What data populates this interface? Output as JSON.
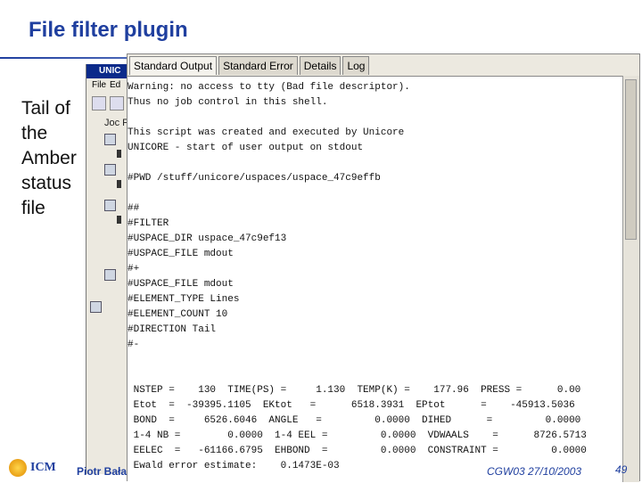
{
  "slide": {
    "title": "File filter plugin",
    "bullet_lines": [
      "Tail of",
      "the",
      "Amber",
      "status",
      "file"
    ],
    "footer_author": "Piotr Bała",
    "footer_event": "CGW03 27/10/2003",
    "page_number": "49",
    "logo_text": "ICM"
  },
  "background_window": {
    "title": "UNIC",
    "menu": [
      "File",
      "Ed"
    ],
    "tree_labels": [
      "Joc F",
      "",
      "",
      "",
      ""
    ]
  },
  "dialog": {
    "tabs": [
      {
        "label": "Standard Output",
        "active": true
      },
      {
        "label": "Standard Error",
        "active": false
      },
      {
        "label": "Details",
        "active": false
      },
      {
        "label": "Log",
        "active": false
      }
    ],
    "lines": [
      "Warning: no access to tty (Bad file descriptor).",
      "Thus no job control in this shell.",
      "",
      "This script was created and executed by Unicore",
      "UNICORE - start of user output on stdout",
      "",
      "#PWD /stuff/unicore/uspaces/uspace_47c9effb",
      "",
      "##",
      "#FILTER",
      "#USPACE_DIR uspace_47c9ef13",
      "#USPACE_FILE mdout",
      "#+",
      "#USPACE_FILE mdout",
      "#ELEMENT_TYPE Lines",
      "#ELEMENT_COUNT 10",
      "#DIRECTION Tail",
      "#-",
      "",
      "",
      " NSTEP =    130  TIME(PS) =     1.130  TEMP(K) =    177.96  PRESS =      0.00",
      " Etot  =  -39395.1105  EKtot   =      6518.3931  EPtot      =    -45913.5036",
      " BOND  =     6526.6046  ANGLE   =         0.0000  DIHED      =         0.0000",
      " 1-4 NB =        0.0000  1-4 EEL =         0.0000  VDWAALS    =      8726.5713",
      " EELEC  =   -61166.6795  EHBOND  =         0.0000  CONSTRAINT =         0.0000",
      " Ewald error estimate:    0.1473E-03"
    ]
  },
  "colors": {
    "title_blue": "#1f3f9f",
    "window_titlebar": "#0b2a8a"
  }
}
